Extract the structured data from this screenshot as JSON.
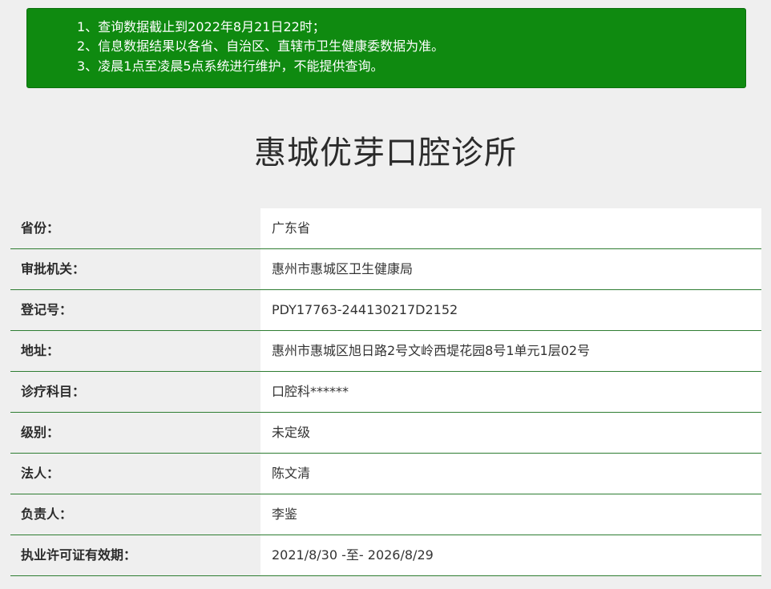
{
  "notice": {
    "lines": [
      "1、查询数据截止到2022年8月21日22时；",
      "2、信息数据结果以各省、自治区、直辖市卫生健康委数据为准。",
      "3、凌晨1点至凌晨5点系统进行维护，不能提供查询。"
    ]
  },
  "title": "惠城优芽口腔诊所",
  "rows": [
    {
      "label": "省份：",
      "value": "广东省"
    },
    {
      "label": "审批机关：",
      "value": "惠州市惠城区卫生健康局"
    },
    {
      "label": "登记号：",
      "value": "PDY17763-244130217D2152"
    },
    {
      "label": "地址：",
      "value": "惠州市惠城区旭日路2号文岭西堤花园8号1单元1层02号"
    },
    {
      "label": "诊疗科目：",
      "value": "口腔科******"
    },
    {
      "label": "级别：",
      "value": "未定级"
    },
    {
      "label": "法人：",
      "value": "陈文清"
    },
    {
      "label": "负责人：",
      "value": "李鉴"
    },
    {
      "label": "执业许可证有效期：",
      "value": "2021/8/30 -至- 2026/8/29"
    }
  ]
}
